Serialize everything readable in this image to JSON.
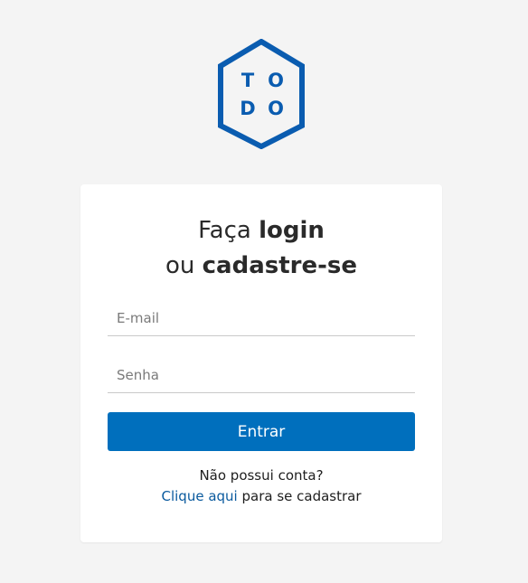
{
  "logo": {
    "letters": [
      "T",
      "O",
      "D",
      "O"
    ],
    "color": "#0a5cb0"
  },
  "heading": {
    "line1_prefix": "Faça ",
    "line1_bold": "login",
    "line2_prefix": "ou ",
    "line2_bold": "cadastre-se"
  },
  "form": {
    "email_placeholder": "E-mail",
    "password_placeholder": "Senha",
    "submit_label": "Entrar",
    "submit_color": "#006fbd"
  },
  "signup": {
    "question": "Não possui conta?",
    "link_text": "Clique aqui",
    "link_suffix": " para se cadastrar"
  }
}
